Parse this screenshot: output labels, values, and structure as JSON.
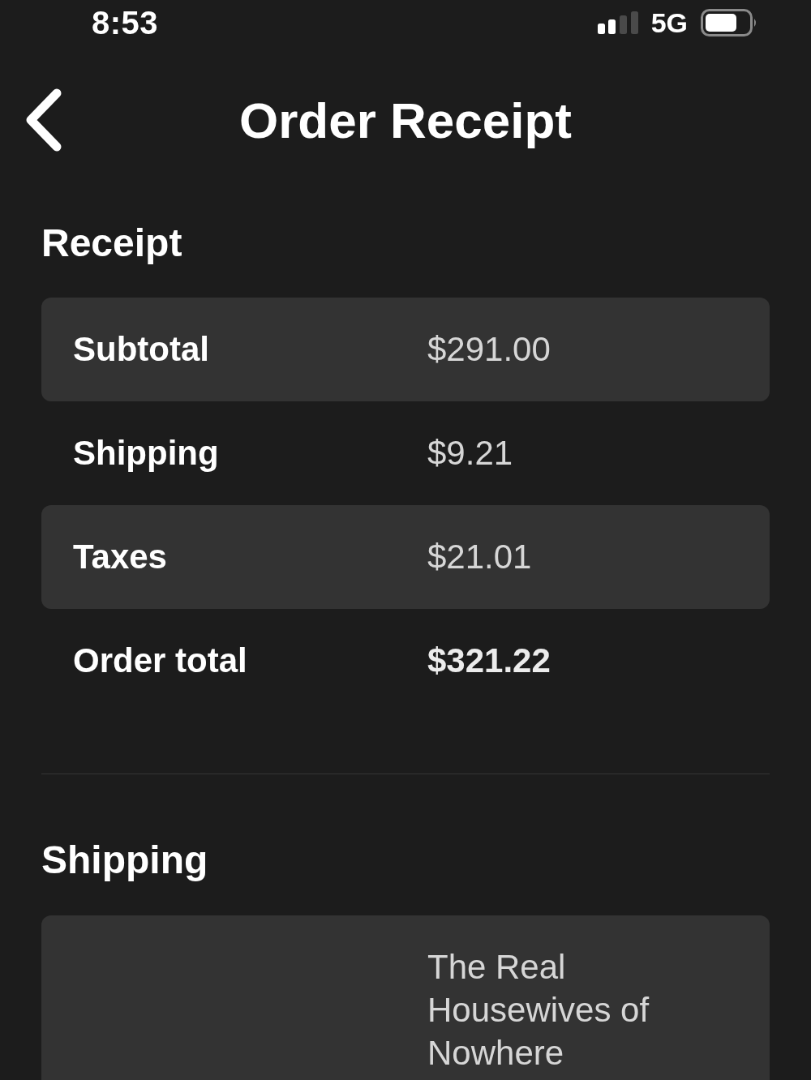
{
  "status_bar": {
    "time": "8:53",
    "network": "5G"
  },
  "nav_bar": {
    "title": "Order Receipt"
  },
  "receipt": {
    "heading": "Receipt",
    "rows": [
      {
        "label": "Subtotal",
        "value": "$291.00",
        "kind": "item"
      },
      {
        "label": "Shipping",
        "value": "$9.21",
        "kind": "item"
      },
      {
        "label": "Taxes",
        "value": "$21.01",
        "kind": "item"
      },
      {
        "label": "Order total",
        "value": "$321.22",
        "kind": "total"
      }
    ]
  },
  "shipping": {
    "heading": "Shipping",
    "rows": [
      {
        "value": "The Real Housewives of Nowhere"
      }
    ]
  }
}
